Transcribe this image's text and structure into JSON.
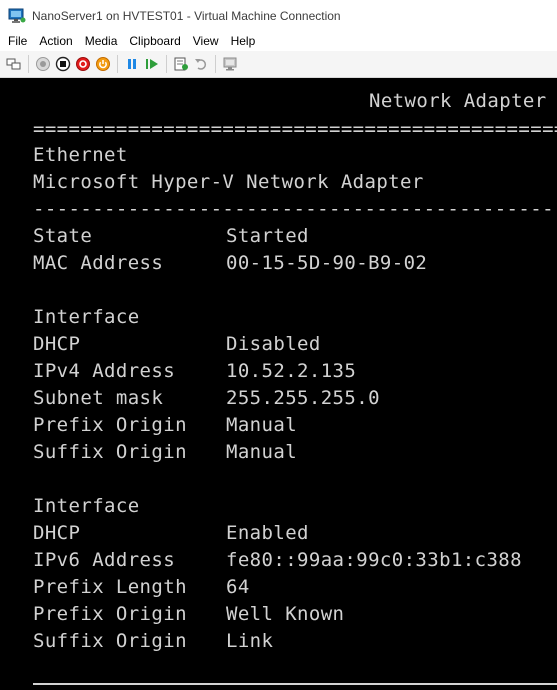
{
  "window": {
    "title": "NanoServer1 on HVTEST01 - Virtual Machine Connection"
  },
  "menu": [
    "File",
    "Action",
    "Media",
    "Clipboard",
    "View",
    "Help"
  ],
  "toolbar": {
    "icons": [
      "ctrl-alt-del-icon",
      "start-icon",
      "turn-off-icon",
      "shut-down-icon",
      "power-icon",
      "pause-icon",
      "resume-icon",
      "checkpoint-icon",
      "revert-icon",
      "enhanced-session-icon"
    ]
  },
  "console": {
    "heading": "Network Adapter",
    "double_rule": "=======================================================",
    "adapter_type": "Ethernet",
    "adapter_name": "Microsoft Hyper-V Network Adapter",
    "single_rule": "-------------------------------------------------------",
    "state_label": "State",
    "state_value": "Started",
    "mac_label": "MAC Address",
    "mac_value": "00-15-5D-90-B9-02",
    "iface1": {
      "heading": "Interface",
      "dhcp_label": "DHCP",
      "dhcp_value": "Disabled",
      "ipv4_label": "IPv4 Address",
      "ipv4_value": "10.52.2.135",
      "subnet_label": "Subnet mask",
      "subnet_value": "255.255.255.0",
      "prefix_origin_label": "Prefix Origin",
      "prefix_origin_value": "Manual",
      "suffix_origin_label": "Suffix Origin",
      "suffix_origin_value": "Manual"
    },
    "iface2": {
      "heading": "Interface",
      "dhcp_label": "DHCP",
      "dhcp_value": "Enabled",
      "ipv6_label": "IPv6 Address",
      "ipv6_value": "fe80::99aa:99c0:33b1:c388",
      "prefix_length_label": "Prefix Length",
      "prefix_length_value": "64",
      "prefix_origin_label": "Prefix Origin",
      "prefix_origin_value": "Well Known",
      "suffix_origin_label": "Suffix Origin",
      "suffix_origin_value": "Link"
    }
  }
}
